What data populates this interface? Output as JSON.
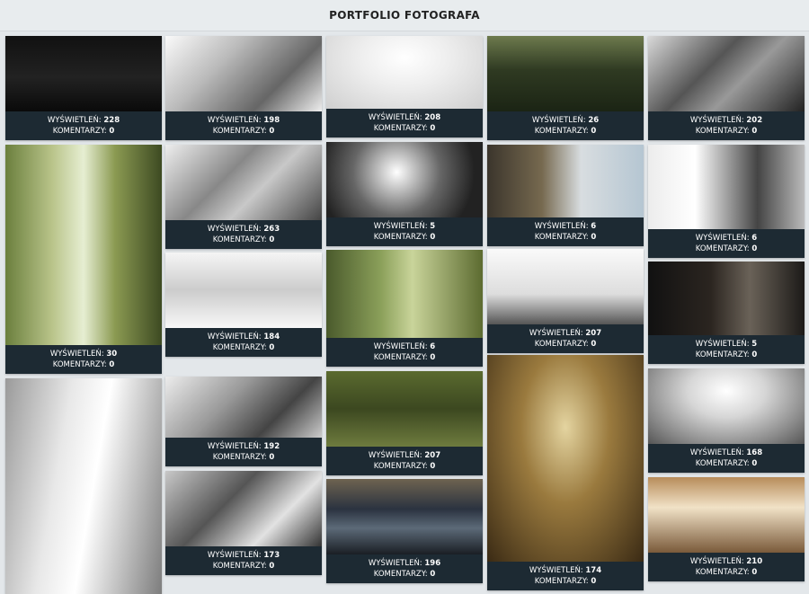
{
  "header": {
    "title": "PORTFOLIO FOTOGRAFA"
  },
  "labels": {
    "views": "WYŚWIETLEŃ:",
    "comments": "KOMENTARZY:"
  },
  "tiles": [
    {
      "views": "228",
      "comments": "0",
      "name": "photo-silhouette-staircase"
    },
    {
      "views": "198",
      "comments": "0",
      "name": "photo-wedding-car"
    },
    {
      "views": "208",
      "comments": "0",
      "name": "photo-couple-snow"
    },
    {
      "views": "26",
      "comments": "0",
      "name": "photo-forest-couple"
    },
    {
      "views": "202",
      "comments": "0",
      "name": "photo-clock-couple"
    },
    {
      "views": "30",
      "comments": "0",
      "name": "photo-couple-trees"
    },
    {
      "views": "263",
      "comments": "0",
      "name": "photo-family-group"
    },
    {
      "views": "5",
      "comments": "0",
      "name": "photo-church-window"
    },
    {
      "views": "6",
      "comments": "0",
      "name": "photo-room-window"
    },
    {
      "views": "6",
      "comments": "0",
      "name": "photo-bride-city"
    },
    {
      "views": "184",
      "comments": "0",
      "name": "photo-veil-bw"
    },
    {
      "views": "6",
      "comments": "0",
      "name": "photo-forest-fern"
    },
    {
      "views": "207",
      "comments": "0",
      "name": "photo-branches"
    },
    {
      "views": "5",
      "comments": "0",
      "name": "photo-dark-window"
    },
    {
      "views": "192",
      "comments": "0",
      "name": "photo-family-bw"
    },
    {
      "views": "207",
      "comments": "0",
      "name": "photo-park-couple"
    },
    {
      "views": "174",
      "comments": "0",
      "name": "photo-church-ceremony"
    },
    {
      "views": "168",
      "comments": "0",
      "name": "photo-ripple"
    },
    {
      "views": "173",
      "comments": "0",
      "name": "photo-lace-dress"
    },
    {
      "views": "196",
      "comments": "0",
      "name": "photo-vintage-car"
    },
    {
      "views": "210",
      "comments": "0",
      "name": "photo-church-interior"
    },
    {
      "views": "",
      "comments": "",
      "name": "photo-bride-portrait"
    }
  ]
}
